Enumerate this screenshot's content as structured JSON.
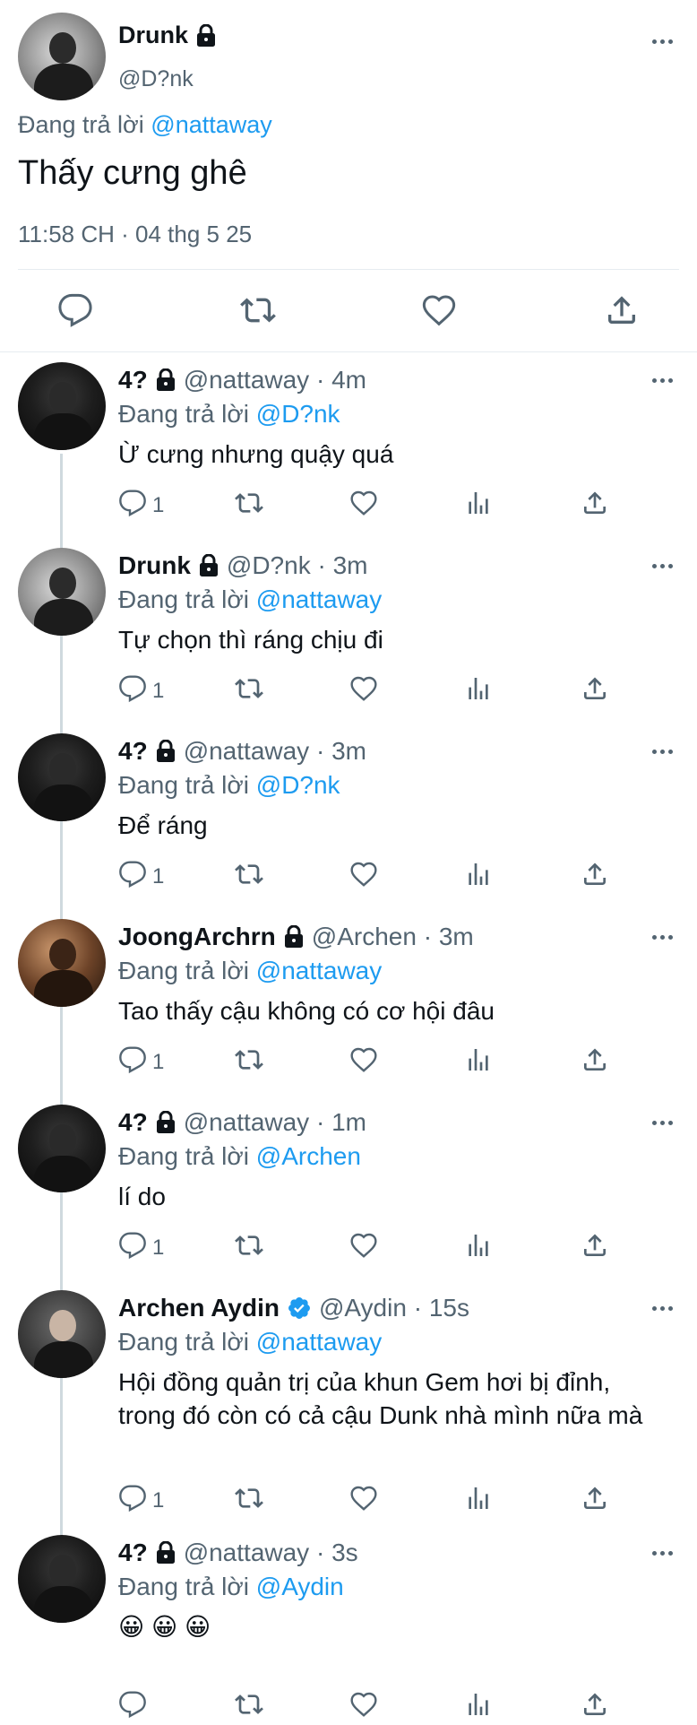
{
  "main_tweet": {
    "name": "Drunk",
    "handle": "@D?nk",
    "replying_prefix": "Đang trả lời",
    "replying_to": "@nattaway",
    "text": "Thấy cưng ghê",
    "timestamp": "11:58 CH · 04 thg 5 25",
    "avatar_icon": "avatar-photo"
  },
  "colors": {
    "link": "#1d9bf0",
    "secondary_text": "#536471",
    "divider": "#e6ecf0",
    "verified": "#1d9bf0"
  },
  "replies": [
    {
      "name": "4?",
      "handle": "@nattaway",
      "time": "4m",
      "replying_to": "@D?nk",
      "text": "Ừ cưng nhưng quậy quá",
      "reply_count": "1",
      "locked": true,
      "verified": false
    },
    {
      "name": "Drunk",
      "handle": "@D?nk",
      "time": "3m",
      "replying_to": "@nattaway",
      "text": "Tự chọn thì ráng chịu đi",
      "reply_count": "1",
      "locked": true,
      "verified": false
    },
    {
      "name": "4?",
      "handle": "@nattaway",
      "time": "3m",
      "replying_to": "@D?nk",
      "text": "Để ráng",
      "reply_count": "1",
      "locked": true,
      "verified": false
    },
    {
      "name": "JoongArchrn",
      "handle": "@Archen",
      "time": "3m",
      "replying_to": "@nattaway",
      "text": "Tao thấy cậu không có cơ hội đâu",
      "reply_count": "1",
      "locked": true,
      "verified": false
    },
    {
      "name": "4?",
      "handle": "@nattaway",
      "time": "1m",
      "replying_to": "@Archen",
      "text": "lí do",
      "reply_count": "1",
      "locked": true,
      "verified": false
    },
    {
      "name": "Archen Aydin",
      "handle": "@Aydin",
      "time": "15s",
      "replying_to": "@nattaway",
      "text": "Hội đồng quản trị của khun Gem hơi bị đỉnh, trong đó còn có cả cậu Dunk nhà mình nữa mà",
      "reply_count": "1",
      "locked": false,
      "verified": true
    },
    {
      "name": "4?",
      "handle": "@nattaway",
      "time": "3s",
      "replying_to": "@Aydin",
      "text": "😀 😀 😀",
      "reply_count": "",
      "locked": true,
      "verified": false
    }
  ],
  "icons": {
    "reply": "reply-icon",
    "retweet": "retweet-icon",
    "like": "heart-icon",
    "views": "views-icon",
    "share": "share-icon",
    "more": "more-icon",
    "lock": "lock-icon",
    "verified": "verified-icon"
  }
}
